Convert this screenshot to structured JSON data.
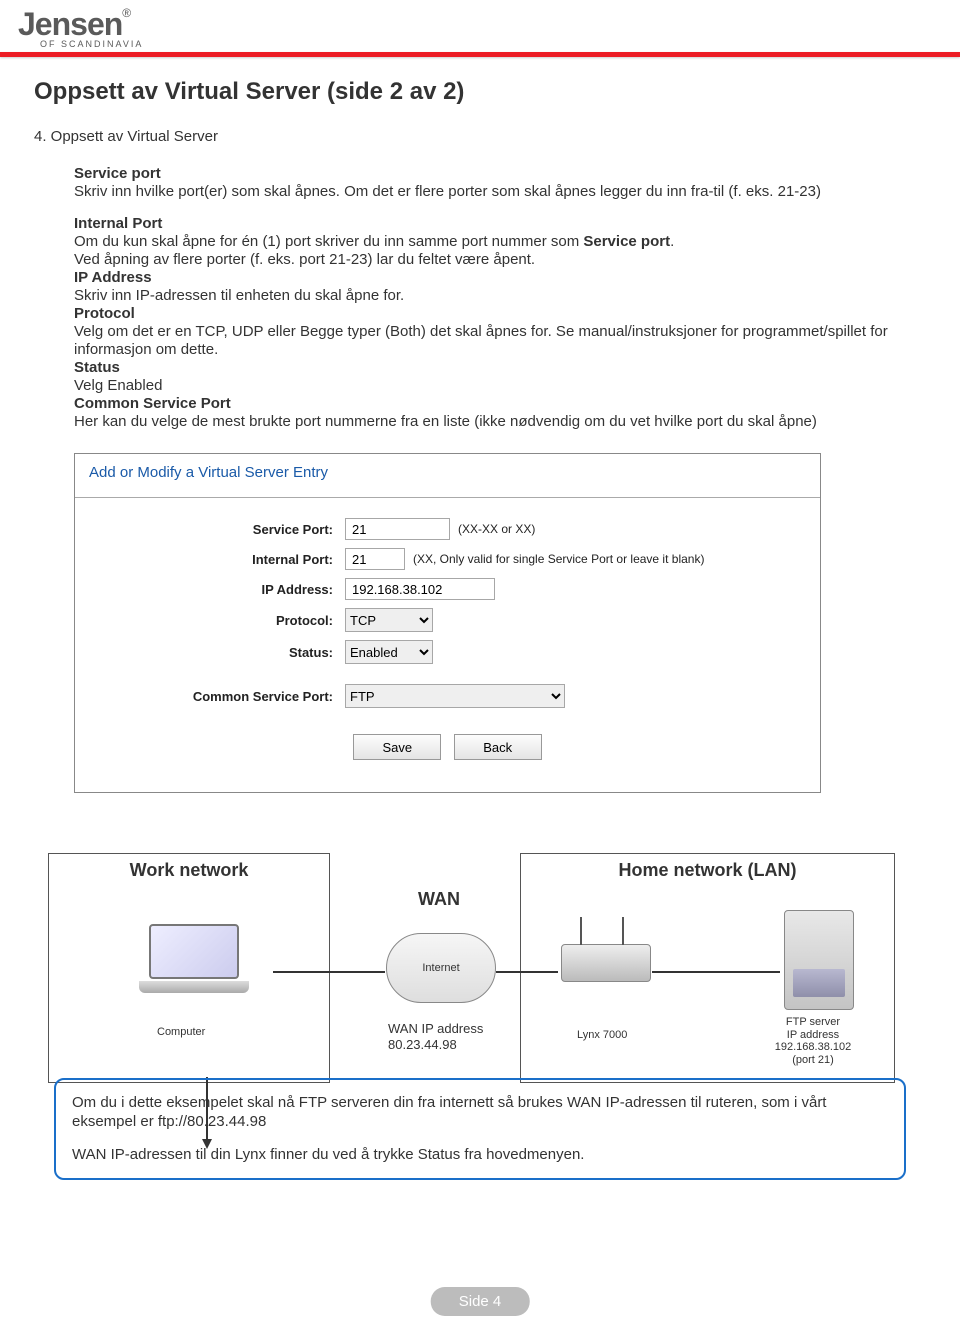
{
  "brand": {
    "name": "Jensen",
    "reg": "®",
    "sub": "OF SCANDINAVIA"
  },
  "title": "Oppsett av Virtual Server  (side 2 av 2)",
  "step4": "4. Oppsett av Virtual Server",
  "defs": {
    "servicePort_h": "Service port",
    "servicePort_t": "Skriv inn hvilke port(er) som skal åpnes. Om det er flere porter som skal åpnes legger du inn fra-til (f. eks. 21-23)",
    "internalPort_h": "Internal Port",
    "internalPort_t1": "Om du kun skal åpne for én (1) port skriver du inn samme port nummer som ",
    "internalPort_t1b": "Service port",
    "internalPort_t1c": ".",
    "internalPort_t2": "Ved åpning av flere porter (f. eks. port 21-23) lar du feltet være åpent.",
    "ip_h": "IP Address",
    "ip_t": "Skriv inn IP-adressen til enheten du skal åpne for.",
    "proto_h": "Protocol",
    "proto_t": "Velg om det er en TCP, UDP eller Begge typer (Both) det skal åpnes for. Se manual/instruksjoner for programmet/spillet for informasjon om dette.",
    "status_h": "Status",
    "status_t": "Velg Enabled",
    "csp_h": "Common Service Port",
    "csp_t": "Her kan du velge de mest brukte port nummerne fra en liste (ikke nødvendig om du vet hvilke port du skal åpne)"
  },
  "panel": {
    "head": "Add or Modify a Virtual Server Entry",
    "rows": {
      "servicePort": {
        "label": "Service Port:",
        "value": "21",
        "hint": "(XX-XX or XX)"
      },
      "internalPort": {
        "label": "Internal Port:",
        "value": "21",
        "hint": "(XX, Only valid for single Service Port or leave it blank)"
      },
      "ip": {
        "label": "IP Address:",
        "value": "192.168.38.102"
      },
      "protocol": {
        "label": "Protocol:",
        "value": "TCP"
      },
      "status": {
        "label": "Status:",
        "value": "Enabled"
      },
      "csp": {
        "label": "Common Service Port:",
        "value": "FTP"
      }
    },
    "save": "Save",
    "back": "Back"
  },
  "diagram": {
    "work": "Work network",
    "computer": "Computer",
    "wan": "WAN",
    "internet": "Internet",
    "wanIp1": "WAN IP address",
    "wanIp2": "80.23.44.98",
    "home": "Home network (LAN)",
    "lynx": "Lynx 7000",
    "ftp1": "FTP server",
    "ftp2": "IP address 192.168.38.102",
    "ftp3": "(port 21)"
  },
  "info": {
    "l1": "Om du i dette eksempelet skal nå FTP serveren din fra internett så brukes WAN IP-adressen til ruteren, som i vårt eksempel er ftp://80.23.44.98",
    "l2": "WAN IP-adressen til din Lynx finner du ved å trykke Status fra hovedmenyen."
  },
  "footer": "Side 4"
}
